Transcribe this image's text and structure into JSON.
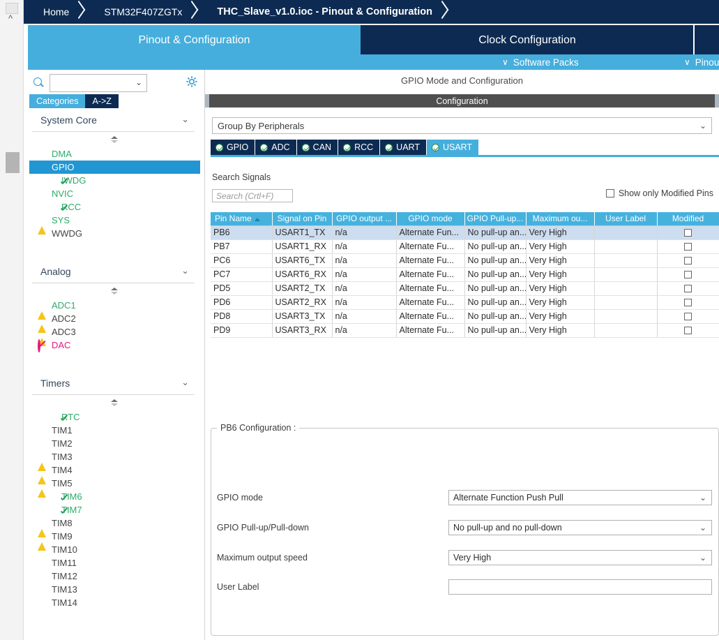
{
  "breadcrumb": {
    "items": [
      {
        "label": "Home",
        "active": false
      },
      {
        "label": "STM32F407ZGTx",
        "active": false
      },
      {
        "label": "THC_Slave_v1.0.ioc - Pinout & Configuration",
        "active": true
      }
    ]
  },
  "main_tabs": [
    {
      "label": "Pinout & Configuration",
      "active": true
    },
    {
      "label": "Clock Configuration",
      "active": false
    },
    {
      "label": "",
      "active": false
    }
  ],
  "subbar": {
    "software_packs": "Software Packs",
    "pinout": "Pinout",
    "chevron": "∨"
  },
  "sidebar": {
    "search_value": "",
    "gear_icon": "gear-icon",
    "search_icon": "search-icon",
    "category_tabs": [
      {
        "label": "Categories",
        "active": true
      },
      {
        "label": "A->Z",
        "active": false
      }
    ],
    "groups": [
      {
        "title": "System Core",
        "items": [
          {
            "label": "DMA",
            "badge": "none",
            "style": "green",
            "selected": false
          },
          {
            "label": "GPIO",
            "badge": "none",
            "style": "normal",
            "selected": true
          },
          {
            "label": "IWDG",
            "badge": "check",
            "style": "green",
            "selected": false
          },
          {
            "label": "NVIC",
            "badge": "none",
            "style": "green",
            "selected": false
          },
          {
            "label": "RCC",
            "badge": "check",
            "style": "green",
            "selected": false
          },
          {
            "label": "SYS",
            "badge": "warn",
            "style": "green",
            "selected": false
          },
          {
            "label": "WWDG",
            "badge": "none",
            "style": "normal",
            "selected": false
          }
        ]
      },
      {
        "title": "Analog",
        "items": [
          {
            "label": "ADC1",
            "badge": "warn",
            "style": "green",
            "selected": false
          },
          {
            "label": "ADC2",
            "badge": "warn",
            "style": "normal",
            "selected": false
          },
          {
            "label": "ADC3",
            "badge": "warn",
            "style": "normal",
            "selected": false
          },
          {
            "label": "DAC",
            "badge": "ban",
            "style": "pink",
            "selected": false
          }
        ]
      },
      {
        "title": "Timers",
        "items": [
          {
            "label": "RTC",
            "badge": "check",
            "style": "green",
            "selected": false
          },
          {
            "label": "TIM1",
            "badge": "none",
            "style": "normal",
            "selected": false
          },
          {
            "label": "TIM2",
            "badge": "none",
            "style": "normal",
            "selected": false
          },
          {
            "label": "TIM3",
            "badge": "warn",
            "style": "normal",
            "selected": false
          },
          {
            "label": "TIM4",
            "badge": "warn",
            "style": "normal",
            "selected": false
          },
          {
            "label": "TIM5",
            "badge": "warn",
            "style": "normal",
            "selected": false
          },
          {
            "label": "TIM6",
            "badge": "check",
            "style": "green",
            "selected": false
          },
          {
            "label": "TIM7",
            "badge": "check",
            "style": "green",
            "selected": false
          },
          {
            "label": "TIM8",
            "badge": "warn",
            "style": "normal",
            "selected": false
          },
          {
            "label": "TIM9",
            "badge": "warn",
            "style": "normal",
            "selected": false
          },
          {
            "label": "TIM10",
            "badge": "none",
            "style": "normal",
            "selected": false
          },
          {
            "label": "TIM11",
            "badge": "none",
            "style": "normal",
            "selected": false
          },
          {
            "label": "TIM12",
            "badge": "none",
            "style": "normal",
            "selected": false
          },
          {
            "label": "TIM13",
            "badge": "none",
            "style": "normal",
            "selected": false
          },
          {
            "label": "TIM14",
            "badge": "none",
            "style": "normal",
            "selected": false
          }
        ]
      }
    ]
  },
  "panel": {
    "gpio_title": "GPIO Mode and Configuration",
    "configuration_band": "Configuration",
    "group_by": "Group By Peripherals",
    "peripheral_tabs": [
      {
        "label": "GPIO",
        "active": false
      },
      {
        "label": "ADC",
        "active": false
      },
      {
        "label": "CAN",
        "active": false
      },
      {
        "label": "RCC",
        "active": false
      },
      {
        "label": "UART",
        "active": false
      },
      {
        "label": "USART",
        "active": true
      }
    ],
    "search_signals_label": "Search Signals",
    "search_placeholder": "Search (Crtl+F)",
    "show_only_modified": "Show only Modified Pins",
    "table": {
      "headers": [
        "Pin Name",
        "Signal on Pin",
        "GPIO output ...",
        "GPIO mode",
        "GPIO Pull-up...",
        "Maximum ou...",
        "User Label",
        "Modified"
      ],
      "sort_column": "Pin Name",
      "rows": [
        {
          "pin": "PB6",
          "signal": "USART1_TX",
          "output": "n/a",
          "mode": "Alternate Fun...",
          "pull": "No pull-up an...",
          "speed": "Very High",
          "label": "",
          "modified": false,
          "selected": true
        },
        {
          "pin": "PB7",
          "signal": "USART1_RX",
          "output": "n/a",
          "mode": "Alternate Fu...",
          "pull": "No pull-up an...",
          "speed": "Very High",
          "label": "",
          "modified": false,
          "selected": false
        },
        {
          "pin": "PC6",
          "signal": "USART6_TX",
          "output": "n/a",
          "mode": "Alternate Fu...",
          "pull": "No pull-up an...",
          "speed": "Very High",
          "label": "",
          "modified": false,
          "selected": false
        },
        {
          "pin": "PC7",
          "signal": "USART6_RX",
          "output": "n/a",
          "mode": "Alternate Fu...",
          "pull": "No pull-up an...",
          "speed": "Very High",
          "label": "",
          "modified": false,
          "selected": false
        },
        {
          "pin": "PD5",
          "signal": "USART2_TX",
          "output": "n/a",
          "mode": "Alternate Fu...",
          "pull": "No pull-up an...",
          "speed": "Very High",
          "label": "",
          "modified": false,
          "selected": false
        },
        {
          "pin": "PD6",
          "signal": "USART2_RX",
          "output": "n/a",
          "mode": "Alternate Fu...",
          "pull": "No pull-up an...",
          "speed": "Very High",
          "label": "",
          "modified": false,
          "selected": false
        },
        {
          "pin": "PD8",
          "signal": "USART3_TX",
          "output": "n/a",
          "mode": "Alternate Fu...",
          "pull": "No pull-up an...",
          "speed": "Very High",
          "label": "",
          "modified": false,
          "selected": false
        },
        {
          "pin": "PD9",
          "signal": "USART3_RX",
          "output": "n/a",
          "mode": "Alternate Fu...",
          "pull": "No pull-up an...",
          "speed": "Very High",
          "label": "",
          "modified": false,
          "selected": false
        }
      ]
    },
    "pin_config": {
      "legend": "PB6 Configuration :",
      "fields": [
        {
          "label": "GPIO mode",
          "value": "Alternate Function Push Pull",
          "type": "select"
        },
        {
          "label": "GPIO Pull-up/Pull-down",
          "value": "No pull-up and no pull-down",
          "type": "select"
        },
        {
          "label": "Maximum output speed",
          "value": "Very High",
          "type": "select"
        },
        {
          "label": "User Label",
          "value": "",
          "type": "text"
        }
      ]
    }
  },
  "colors": {
    "navy": "#0d2b52",
    "accent_blue": "#45aedc",
    "table_header": "#45b2de",
    "selected_row": "#cdddf0",
    "green": "#2eab6a",
    "warn_yellow": "#f5c518",
    "pink": "#e5197f"
  }
}
